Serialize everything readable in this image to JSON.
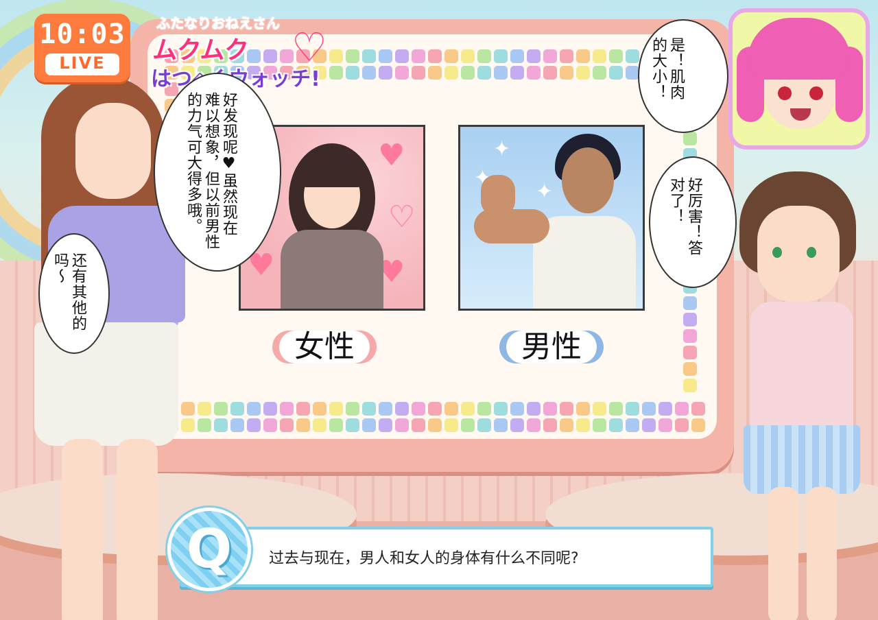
{
  "clock": {
    "time": "10:03",
    "live": "LIVE"
  },
  "logo": {
    "line1": "ふたなりおねえさん",
    "line2": "ムクムク",
    "line3": "はつ◇くウォッチ!"
  },
  "board": {
    "female_label": "女性",
    "male_label": "男性"
  },
  "bubbles": {
    "host_main": "好发现呢♥虽然现在难以想象，但以前男性的力气可大得多哦。",
    "host_side": "还有其他的吗～",
    "avatar_girl": "是！肌肉的大小！",
    "right_girl": "好厉害！答对了！"
  },
  "question": {
    "icon_letter": "Q",
    "text": "过去与现在，男人和女人的身体有什么不同呢?"
  },
  "colors": {
    "accent": "#ff7a3d",
    "question_border": "#7fd0e8",
    "board": "#f4b4a7"
  }
}
